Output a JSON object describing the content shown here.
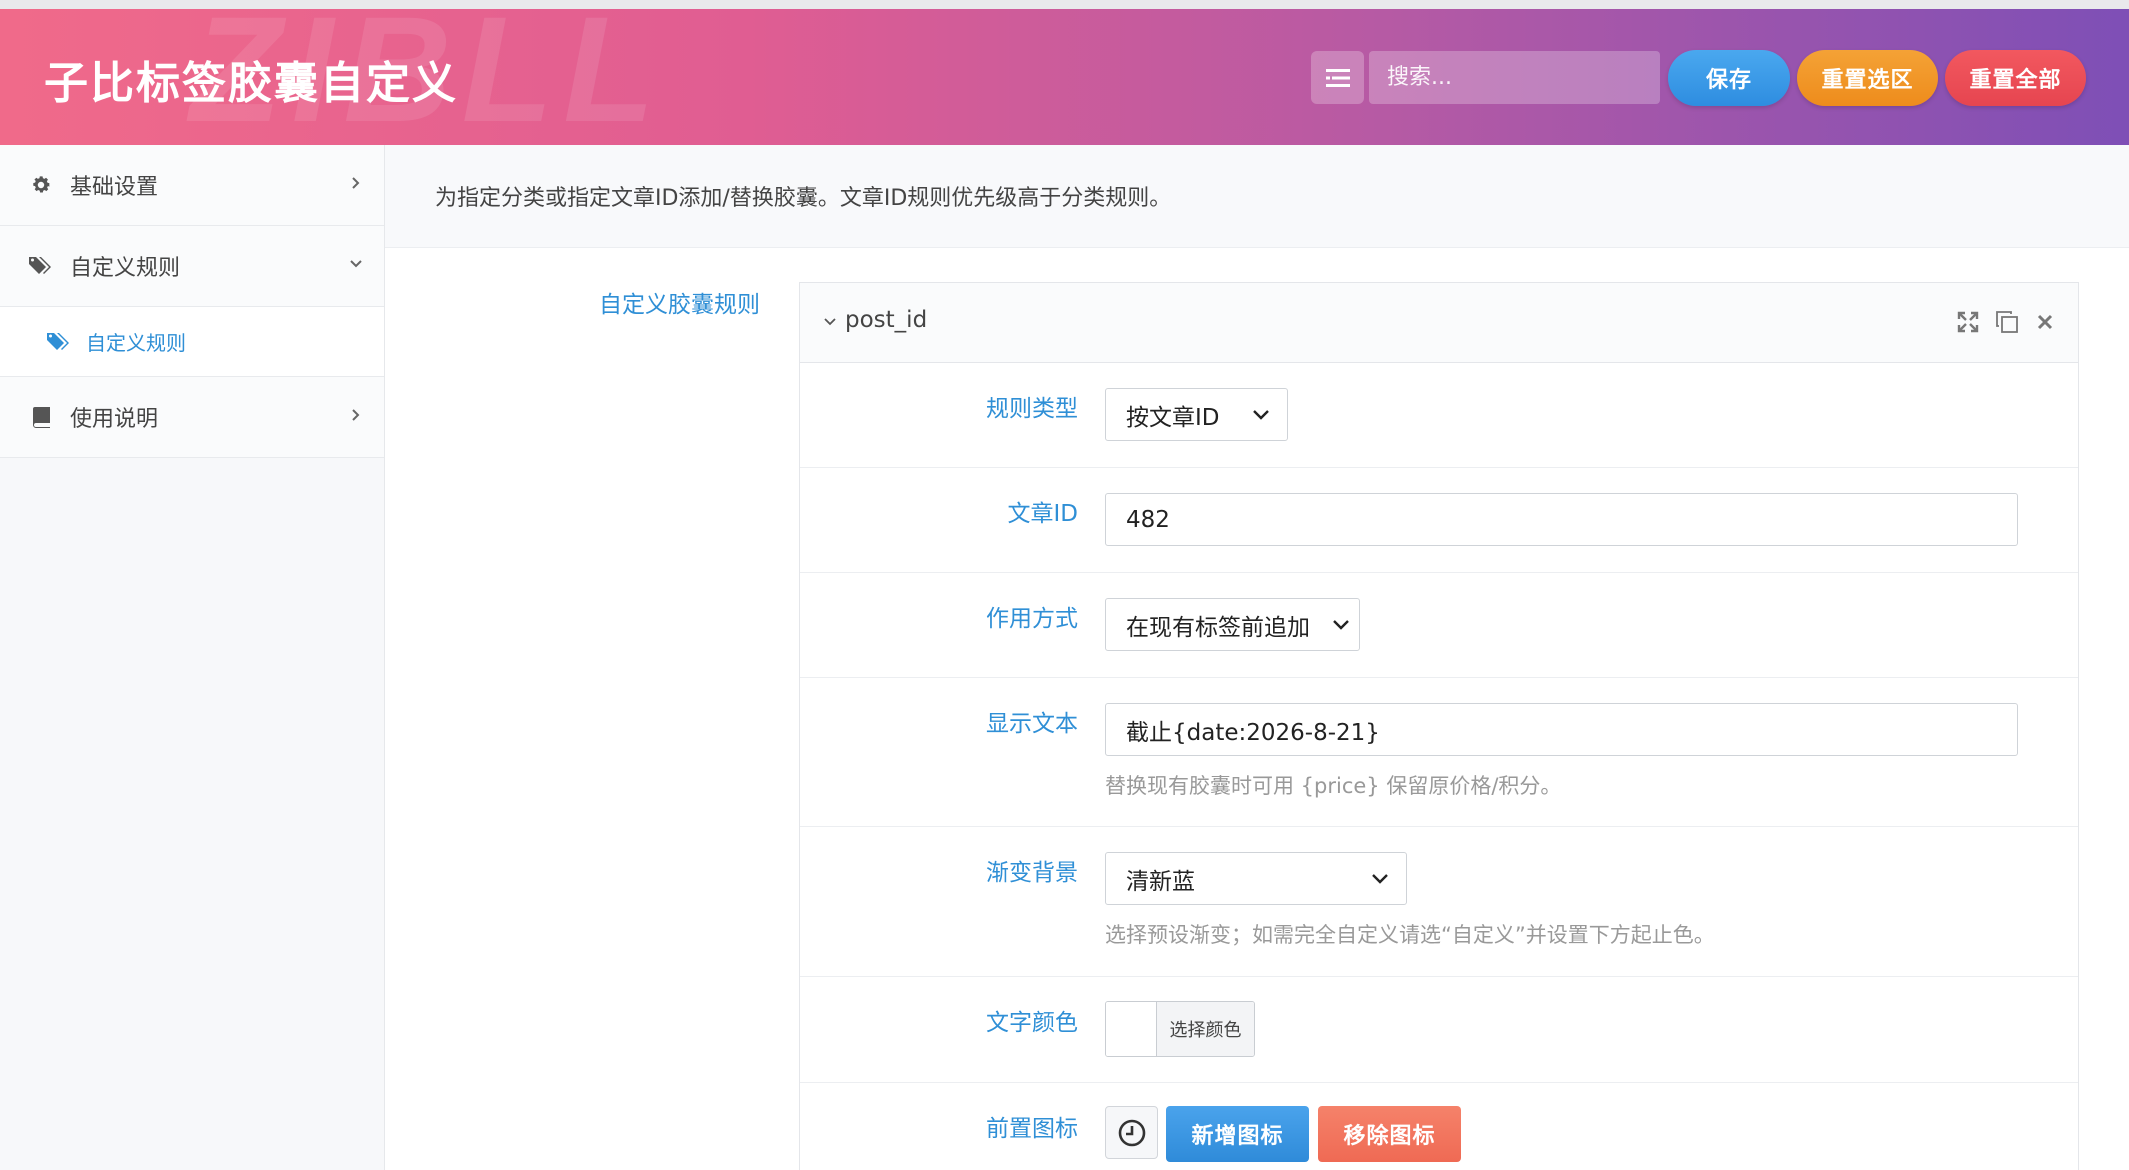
{
  "header": {
    "title": "子比标签胶囊自定义",
    "search_placeholder": "搜索...",
    "save_label": "保存",
    "reset_section_label": "重置选区",
    "reset_all_label": "重置全部"
  },
  "sidebar": {
    "items": [
      {
        "label": "基础设置",
        "icon": "gear-icon",
        "expanded": false
      },
      {
        "label": "自定义规则",
        "icon": "tags-icon",
        "expanded": true
      },
      {
        "label": "使用说明",
        "icon": "book-icon",
        "expanded": false
      }
    ],
    "sub_items": [
      {
        "label": "自定义规则",
        "icon": "tags-icon",
        "active": true
      }
    ]
  },
  "content": {
    "notice": "为指定分类或指定文章ID添加/替换胶囊。文章ID规则优先级高于分类规则。",
    "field_title": "自定义胶囊规则",
    "group": {
      "title": "post_id",
      "fields": {
        "rule_type": {
          "label": "规则类型",
          "value": "按文章ID"
        },
        "post_id": {
          "label": "文章ID",
          "value": "482"
        },
        "mode": {
          "label": "作用方式",
          "value": "在现有标签前追加"
        },
        "display_text": {
          "label": "显示文本",
          "value": "截止{date:2026-8-21}",
          "hint": "替换现有胶囊时可用 {price} 保留原价格/积分。"
        },
        "gradient": {
          "label": "渐变背景",
          "value": "清新蓝",
          "hint": "选择预设渐变；如需完全自定义请选“自定义”并设置下方起止色。"
        },
        "text_color": {
          "label": "文字颜色",
          "button": "选择颜色",
          "value": "#ffffff"
        },
        "prefix_icon": {
          "label": "前置图标",
          "add_label": "新增图标",
          "remove_label": "移除图标",
          "icon": "clock-icon"
        }
      }
    }
  },
  "colors": {
    "accent_blue": "#2f8fd6",
    "save": "#3a9ae8",
    "reset_section": "#f09524",
    "reset_all": "#ea4d56",
    "remove_icon": "#f07660"
  }
}
